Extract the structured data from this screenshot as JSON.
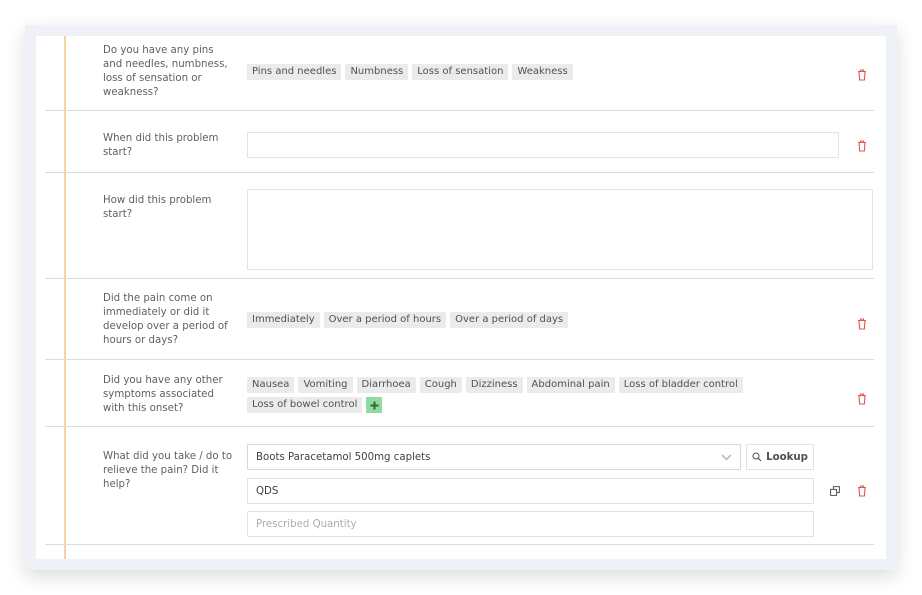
{
  "questions": [
    {
      "label": "Do you have any pins and needles, numbness, loss of sensation or weakness?",
      "type": "tags",
      "tags": [
        "Pins and needles",
        "Numbness",
        "Loss of sensation",
        "Weakness"
      ]
    },
    {
      "label": "When did this problem start?",
      "type": "text",
      "value": ""
    },
    {
      "label": "How did this problem start?",
      "type": "textarea",
      "value": ""
    },
    {
      "label": "Did the pain come on immediately or did it develop over a period of hours or days?",
      "type": "tags",
      "tags": [
        "Immediately",
        "Over a period of hours",
        "Over a period of days"
      ]
    },
    {
      "label": "Did you have any other symptoms associated with this onset?",
      "type": "tags",
      "tags": [
        "Nausea",
        "Vomiting",
        "Diarrhoea",
        "Cough",
        "Dizziness",
        "Abdominal pain",
        "Loss of bladder control",
        "Loss of bowel control"
      ],
      "add_icon": "plus-icon"
    },
    {
      "label": "What did you take / do to relieve the pain? Did it help?",
      "type": "medication",
      "medication": "Boots Paracetamol 500mg caplets",
      "lookup_label": "Lookup",
      "dosage": "QDS",
      "quantity_placeholder": "Prescribed Quantity",
      "quantity": ""
    }
  ],
  "icons": {
    "delete": "trash-icon",
    "duplicate": "copy-icon",
    "search": "search-icon",
    "dropdown": "chevron-down-icon"
  },
  "colors": {
    "accent_line": "#f7d3a4",
    "delete_icon": "#e5544e",
    "add_button": "#8fdc9e",
    "tag_bg": "#ebebeb"
  }
}
